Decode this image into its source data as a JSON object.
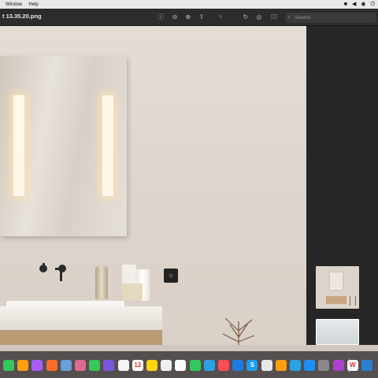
{
  "menubar": {
    "menus": [
      "Window",
      "Help"
    ],
    "status_icons": [
      "stop-icon",
      "volume-icon",
      "play-circle-icon",
      "power-icon"
    ]
  },
  "toolbar": {
    "document_title": "t 13.35.20.png",
    "icons": [
      "info-icon",
      "zoom-out-icon",
      "zoom-in-icon",
      "share-icon",
      "markup-pen-icon",
      "rotate-icon",
      "annotate-icon",
      "crop-icon"
    ],
    "search_placeholder": "Search"
  },
  "sidebar": {
    "thumbnails": [
      "bathroom-thumbnail",
      "partial-thumbnail"
    ]
  },
  "dock": {
    "apps": [
      {
        "icon": "messages-icon",
        "color": "#34c759",
        "glyph": ""
      },
      {
        "icon": "pages-icon",
        "color": "#ff9f0a",
        "glyph": ""
      },
      {
        "icon": "messenger-icon",
        "color": "#a65cf5",
        "glyph": ""
      },
      {
        "icon": "orange-app-icon",
        "color": "#ff6b2c",
        "glyph": ""
      },
      {
        "icon": "preview-icon",
        "color": "#6a9fd8",
        "glyph": ""
      },
      {
        "icon": "launchpad-icon",
        "color": "#e0688f",
        "glyph": ""
      },
      {
        "icon": "facetime-icon",
        "color": "#34c759",
        "glyph": ""
      },
      {
        "icon": "star-app-icon",
        "color": "#7a55e0",
        "glyph": ""
      },
      {
        "icon": "photos-icon",
        "color": "#f4f4f4",
        "glyph": ""
      },
      {
        "icon": "calendar-icon",
        "color": "#ffffff",
        "glyph": "12"
      },
      {
        "icon": "notes-icon",
        "color": "#ffd60a",
        "glyph": ""
      },
      {
        "icon": "photos-app-icon",
        "color": "#f0f0f0",
        "glyph": ""
      },
      {
        "icon": "reminders-icon",
        "color": "#ffffff",
        "glyph": ""
      },
      {
        "icon": "numbers-icon",
        "color": "#34c759",
        "glyph": ""
      },
      {
        "icon": "video-icon",
        "color": "#2ca0e0",
        "glyph": ""
      },
      {
        "icon": "music-icon",
        "color": "#ff4b58",
        "glyph": ""
      },
      {
        "icon": "keynote-icon",
        "color": "#1f7ae0",
        "glyph": ""
      },
      {
        "icon": "skype-icon",
        "color": "#1f9cf0",
        "glyph": "S"
      },
      {
        "icon": "app-grid-icon",
        "color": "#e8e8e8",
        "glyph": ""
      },
      {
        "icon": "books-icon",
        "color": "#ff9f0a",
        "glyph": ""
      },
      {
        "icon": "telegram-icon",
        "color": "#2aa3e0",
        "glyph": ""
      },
      {
        "icon": "app-store-icon",
        "color": "#1e8ef5",
        "glyph": ""
      },
      {
        "icon": "settings-icon",
        "color": "#8a8a8e",
        "glyph": ""
      },
      {
        "icon": "gradient-app-icon",
        "color": "#b040d0",
        "glyph": ""
      },
      {
        "icon": "webflow-icon",
        "color": "#f0f6ff",
        "glyph": "W"
      },
      {
        "icon": "finder-icon",
        "color": "#2a7fd0",
        "glyph": ""
      }
    ]
  }
}
